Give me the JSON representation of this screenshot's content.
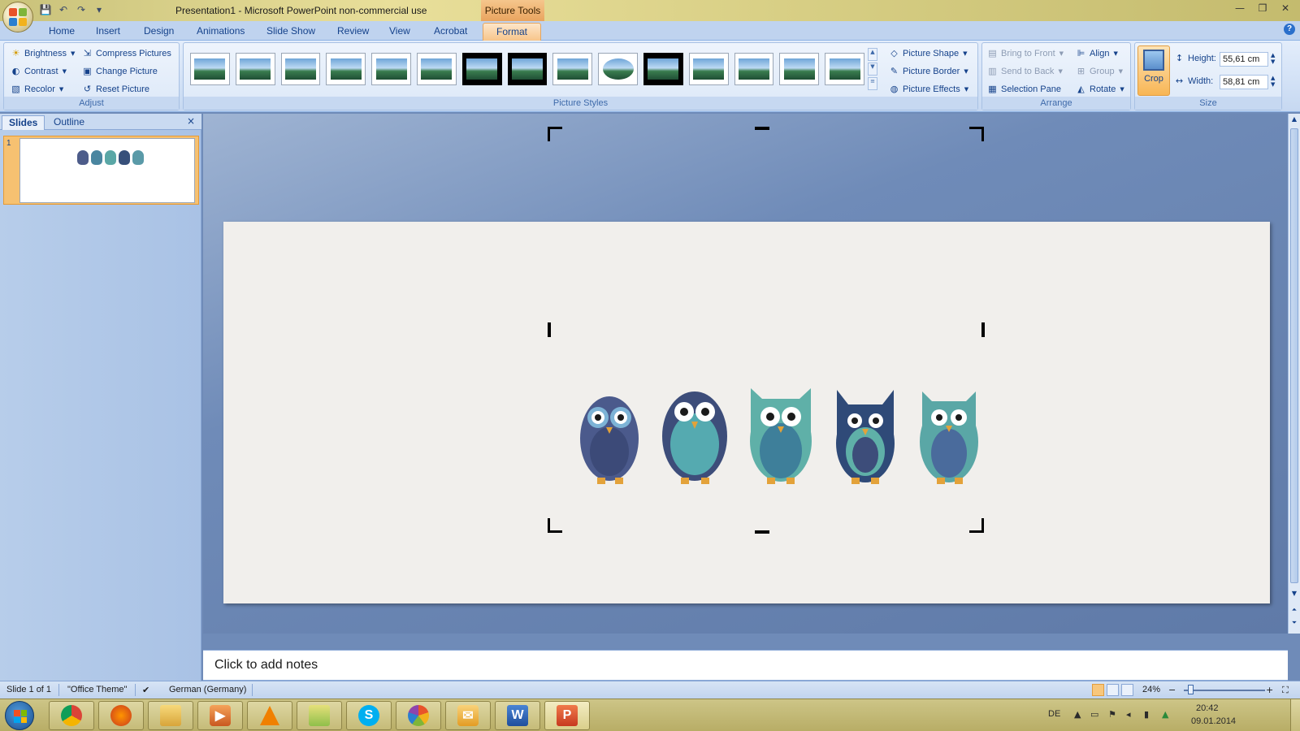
{
  "window": {
    "title": "Presentation1 - Microsoft PowerPoint non-commercial use",
    "context_tab": "Picture Tools",
    "controls": {
      "minimize": "—",
      "restore": "❐",
      "close": "✕"
    }
  },
  "qat": {
    "save": "💾",
    "undo": "↶",
    "redo": "↷",
    "more": "▾"
  },
  "ribbon": {
    "tabs": [
      "Home",
      "Insert",
      "Design",
      "Animations",
      "Slide Show",
      "Review",
      "View",
      "Acrobat",
      "Format"
    ],
    "active_tab": "Format",
    "adjust": {
      "label": "Adjust",
      "brightness": "Brightness",
      "contrast": "Contrast",
      "recolor": "Recolor",
      "compress": "Compress Pictures",
      "change": "Change Picture",
      "reset": "Reset Picture"
    },
    "picture_styles": {
      "label": "Picture Styles",
      "shape": "Picture Shape",
      "border": "Picture Border",
      "effects": "Picture Effects"
    },
    "arrange": {
      "label": "Arrange",
      "bring_front": "Bring to Front",
      "send_back": "Send to Back",
      "selection_pane": "Selection Pane",
      "align": "Align",
      "group": "Group",
      "rotate": "Rotate"
    },
    "size": {
      "label": "Size",
      "crop": "Crop",
      "height_label": "Height:",
      "height_value": "55,61 cm",
      "width_label": "Width:",
      "width_value": "58,81 cm"
    }
  },
  "panel": {
    "tabs": [
      "Slides",
      "Outline"
    ],
    "active_tab": "Slides",
    "close": "×",
    "slide_number": "1"
  },
  "notes": {
    "placeholder": "Click to add notes"
  },
  "status": {
    "slide": "Slide 1 of 1",
    "theme": "\"Office Theme\"",
    "language": "German (Germany)",
    "zoom": "24%",
    "zoom_out": "−",
    "zoom_in": "+"
  },
  "tray": {
    "lang": "DE",
    "time": "20:42",
    "date": "09.01.2014"
  },
  "colors": {
    "accent": "#f8b655",
    "ribbon": "#dce8f8",
    "owl_teal": "#4fa3a5",
    "owl_navy": "#3d4d7a"
  }
}
